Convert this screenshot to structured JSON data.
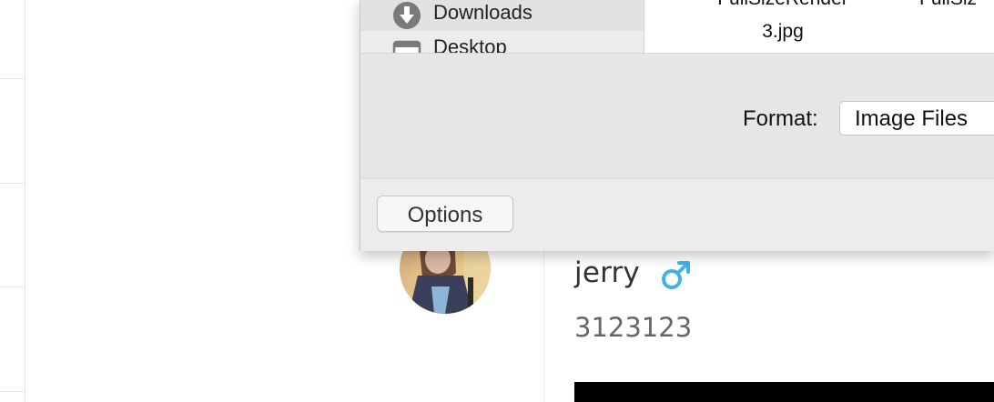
{
  "sheet": {
    "sidebar": {
      "items": [
        {
          "label": "Downloads",
          "icon": "downloads-icon",
          "selected": true
        },
        {
          "label": "Desktop",
          "icon": "desktop-folder-icon",
          "selected": false
        }
      ]
    },
    "files": [
      {
        "name_line1": "FullSizeRender",
        "name_line2": "3.jpg"
      },
      {
        "name_line1": "FullSiz",
        "name_line2": ""
      }
    ],
    "format": {
      "label": "Format:",
      "selected": "Image Files"
    },
    "footer": {
      "options_label": "Options"
    }
  },
  "profile": {
    "name": "jerry",
    "gender_icon": "male-symbol-icon",
    "gender_color": "#3fb3e6",
    "id": "3123123"
  }
}
